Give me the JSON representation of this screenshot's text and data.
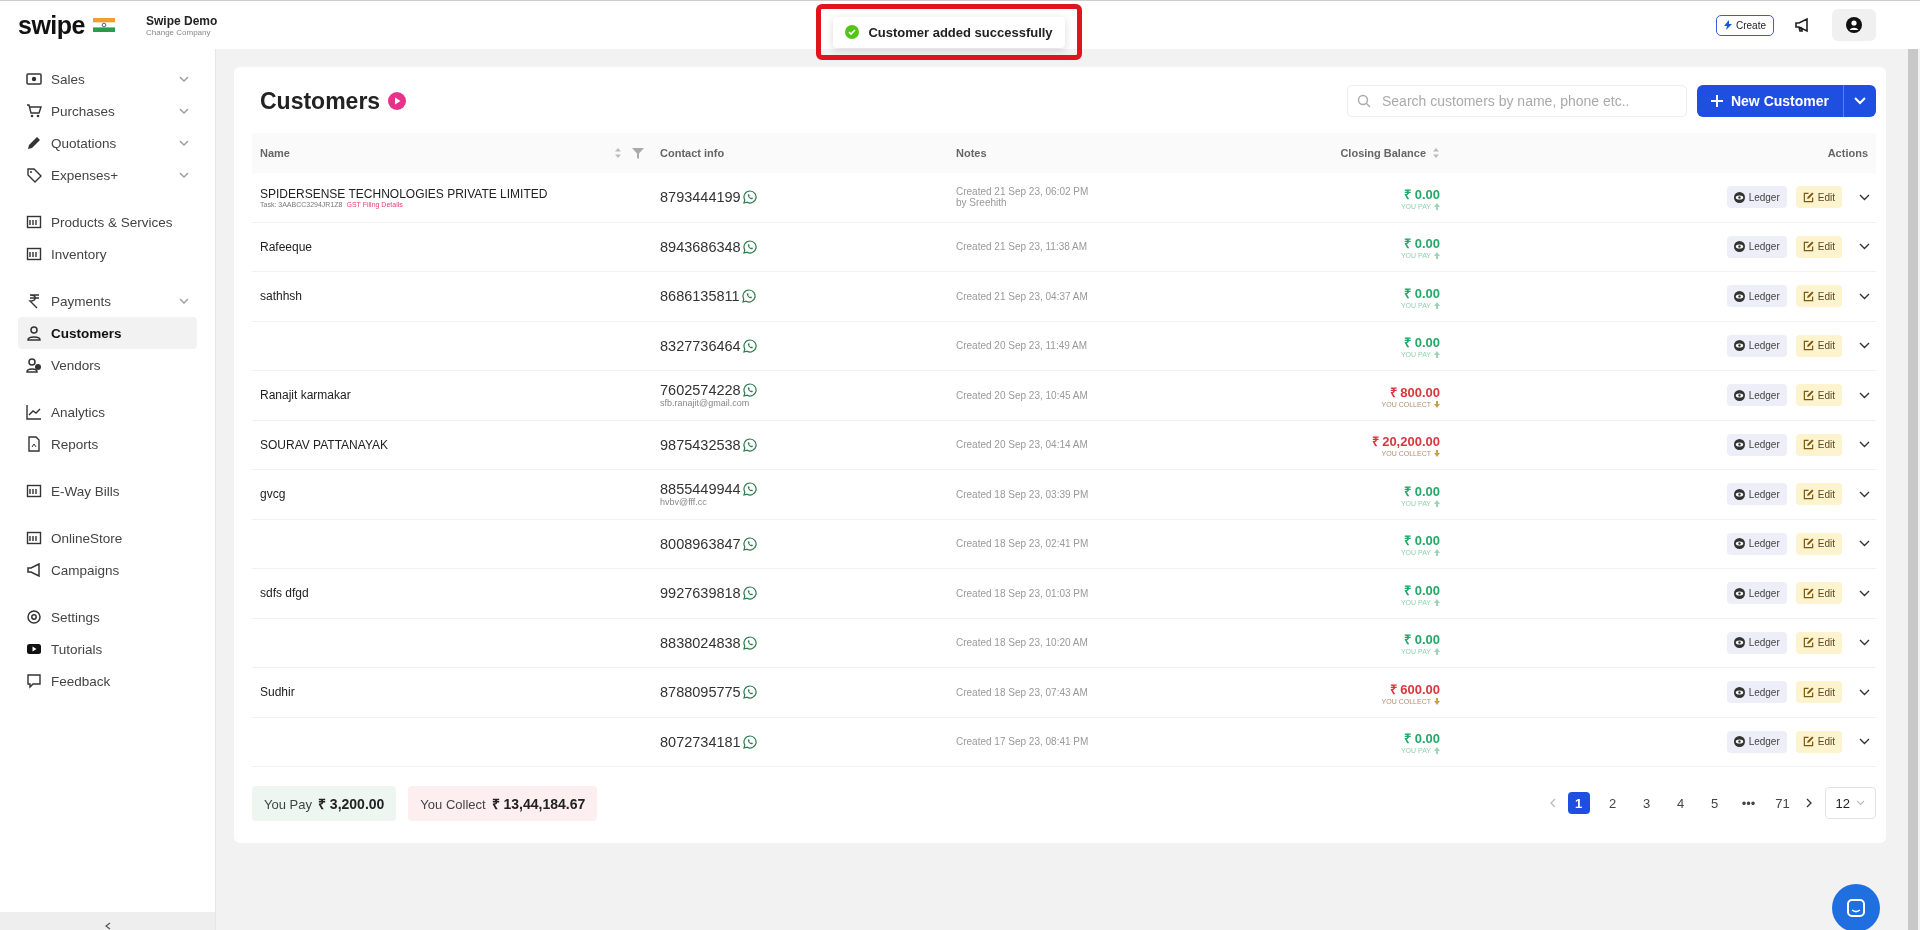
{
  "topbar": {
    "logo": "swipe",
    "company": "Swipe Demo",
    "company_action": "Change Company",
    "create_button": "Create"
  },
  "toast": {
    "message": "Customer added successfully"
  },
  "sidebar": {
    "groups": [
      [
        {
          "label": "Sales",
          "expandable": true,
          "selected": false
        },
        {
          "label": "Purchases",
          "expandable": true,
          "selected": false
        },
        {
          "label": "Quotations",
          "expandable": true,
          "selected": false
        },
        {
          "label": "Expenses+",
          "expandable": true,
          "selected": false
        }
      ],
      [
        {
          "label": "Products & Services",
          "expandable": false,
          "selected": false
        },
        {
          "label": "Inventory",
          "expandable": false,
          "selected": false
        }
      ],
      [
        {
          "label": "Payments",
          "expandable": true,
          "selected": false
        },
        {
          "label": "Customers",
          "expandable": false,
          "selected": true
        },
        {
          "label": "Vendors",
          "expandable": false,
          "selected": false
        }
      ],
      [
        {
          "label": "Analytics",
          "expandable": false,
          "selected": false
        },
        {
          "label": "Reports",
          "expandable": false,
          "selected": false
        }
      ],
      [
        {
          "label": "E-Way Bills",
          "expandable": false,
          "selected": false
        }
      ],
      [
        {
          "label": "OnlineStore",
          "expandable": false,
          "selected": false
        },
        {
          "label": "Campaigns",
          "expandable": false,
          "selected": false
        }
      ],
      [
        {
          "label": "Settings",
          "expandable": false,
          "selected": false
        },
        {
          "label": "Tutorials",
          "expandable": false,
          "selected": false
        },
        {
          "label": "Feedback",
          "expandable": false,
          "selected": false
        }
      ]
    ]
  },
  "page": {
    "title": "Customers",
    "search": {
      "placeholder": "Search customers by name, phone etc.."
    },
    "new_button": "New Customer"
  },
  "table": {
    "columns": [
      "Name",
      "Contact info",
      "Notes",
      "Closing Balance",
      "Actions"
    ],
    "rows": [
      {
        "name": "SPIDERSENSE TECHNOLOGIES PRIVATE LIMITED",
        "tax": "Task: 3AABCC3294JR1Z8",
        "tax_link": "GST Filing Details",
        "phone": "8793444199",
        "email": "",
        "note": "Created 21 Sep 23, 06:02 PM",
        "note_by": "by Sreehith",
        "amount": "₹ 0.00",
        "balance_label": "YOU PAY",
        "kind": "pay"
      },
      {
        "name": "Rafeeque",
        "phone": "8943686348",
        "email": "",
        "note": "Created 21 Sep 23, 11:38 AM",
        "amount": "₹ 0.00",
        "balance_label": "YOU PAY",
        "kind": "pay"
      },
      {
        "name": "sathhsh",
        "phone": "8686135811",
        "email": "",
        "note": "Created 21 Sep 23, 04:37 AM",
        "amount": "₹ 0.00",
        "balance_label": "YOU PAY",
        "kind": "pay"
      },
      {
        "name": "",
        "phone": "8327736464",
        "email": "",
        "note": "Created 20 Sep 23, 11:49 AM",
        "amount": "₹ 0.00",
        "balance_label": "YOU PAY",
        "kind": "pay"
      },
      {
        "name": "Ranajit karmakar",
        "phone": "7602574228",
        "email": "sfb.ranajit@gmail.com",
        "note": "Created 20 Sep 23, 10:45 AM",
        "amount": "₹ 800.00",
        "balance_label": "YOU COLLECT",
        "kind": "collect"
      },
      {
        "name": "SOURAV PATTANAYAK",
        "phone": "9875432538",
        "email": "",
        "note": "Created 20 Sep 23, 04:14 AM",
        "amount": "₹ 20,200.00",
        "balance_label": "YOU COLLECT",
        "kind": "collect"
      },
      {
        "name": "gvcg",
        "phone": "8855449944",
        "email": "hvbv@fff.cc",
        "note": "Created 18 Sep 23, 03:39 PM",
        "amount": "₹ 0.00",
        "balance_label": "YOU PAY",
        "kind": "pay"
      },
      {
        "name": "",
        "phone": "8008963847",
        "email": "",
        "note": "Created 18 Sep 23, 02:41 PM",
        "amount": "₹ 0.00",
        "balance_label": "YOU PAY",
        "kind": "pay"
      },
      {
        "name": "sdfs dfgd",
        "phone": "9927639818",
        "email": "",
        "note": "Created 18 Sep 23, 01:03 PM",
        "amount": "₹ 0.00",
        "balance_label": "YOU PAY",
        "kind": "pay"
      },
      {
        "name": "",
        "phone": "8838024838",
        "email": "",
        "note": "Created 18 Sep 23, 10:20 AM",
        "amount": "₹ 0.00",
        "balance_label": "YOU PAY",
        "kind": "pay"
      },
      {
        "name": "Sudhir",
        "phone": "8788095775",
        "email": "",
        "note": "Created 18 Sep 23, 07:43 AM",
        "amount": "₹ 600.00",
        "balance_label": "YOU COLLECT",
        "kind": "collect"
      },
      {
        "name": "",
        "phone": "8072734181",
        "email": "",
        "note": "Created 17 Sep 23, 08:41 PM",
        "amount": "₹ 0.00",
        "balance_label": "YOU PAY",
        "kind": "pay"
      }
    ],
    "actions": [
      {
        "ledger": "Ledger",
        "edit": "Edit"
      },
      {
        "ledger": "Ledger",
        "edit": "Edit"
      },
      {
        "ledger": "Ledger",
        "edit": "Edit"
      },
      {
        "ledger": "Ledger",
        "edit": "Edit"
      },
      {
        "ledger": "Ledger",
        "edit": "Edit"
      },
      {
        "ledger": "Ledger",
        "edit": "Edit"
      },
      {
        "ledger": "Ledger",
        "edit": "Edit"
      },
      {
        "ledger": "Ledger",
        "edit": "Edit"
      },
      {
        "ledger": "Ledger",
        "edit": "Edit"
      },
      {
        "ledger": "Ledger",
        "edit": "Edit"
      },
      {
        "ledger": "Ledger",
        "edit": "Edit"
      },
      {
        "ledger": "Ledger",
        "edit": "Edit"
      }
    ]
  },
  "summary": {
    "pay_label": "You Pay",
    "pay_amount": "₹ 3,200.00",
    "collect_label": "You Collect",
    "collect_amount": "₹ 13,44,184.67"
  },
  "pagination": {
    "pages": [
      {
        "label": "1",
        "selected": true
      },
      {
        "label": "2",
        "selected": false
      },
      {
        "label": "3",
        "selected": false
      },
      {
        "label": "4",
        "selected": false
      },
      {
        "label": "5",
        "selected": false
      },
      {
        "label": "•••",
        "selected": false
      },
      {
        "label": "71",
        "selected": false
      }
    ],
    "page_size": "12"
  }
}
